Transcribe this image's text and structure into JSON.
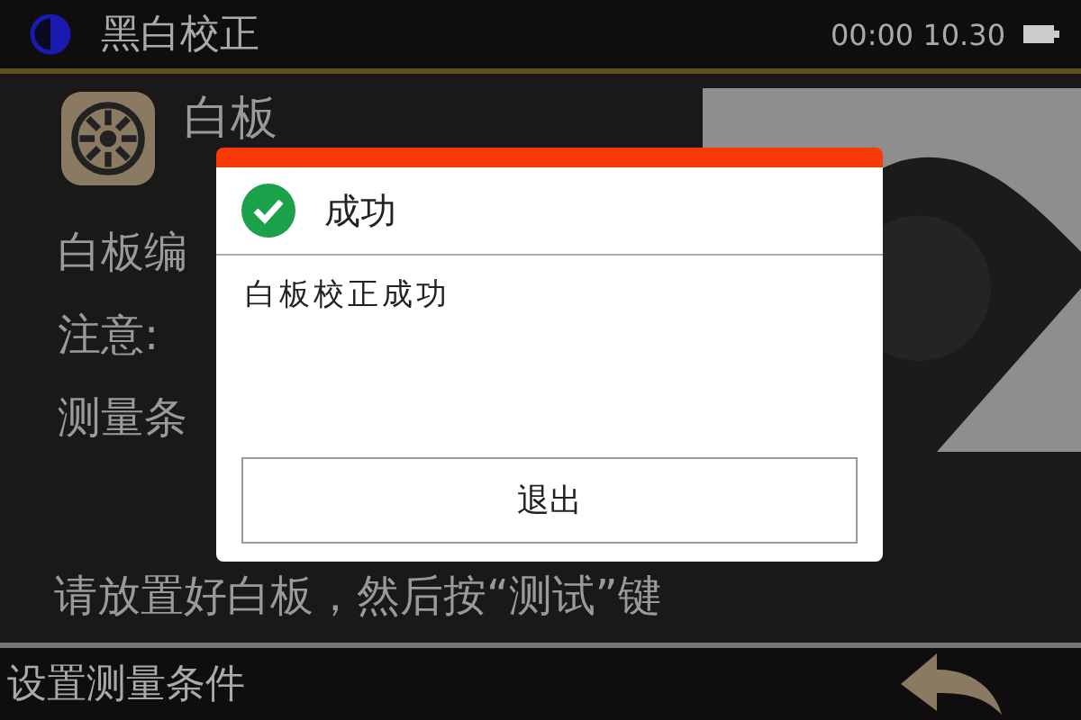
{
  "title_bar": {
    "title": "黑白校正",
    "time": "00:00 10.30"
  },
  "content": {
    "heading": "白板",
    "lines": [
      "白板编",
      "注意:",
      "测量条"
    ],
    "instruction": "请放置好白板，然后按“测试”键"
  },
  "dialog": {
    "title": "成功",
    "message": "白板校正成功",
    "button": "退出"
  },
  "bottom_bar": {
    "label": "设置测量条件"
  }
}
